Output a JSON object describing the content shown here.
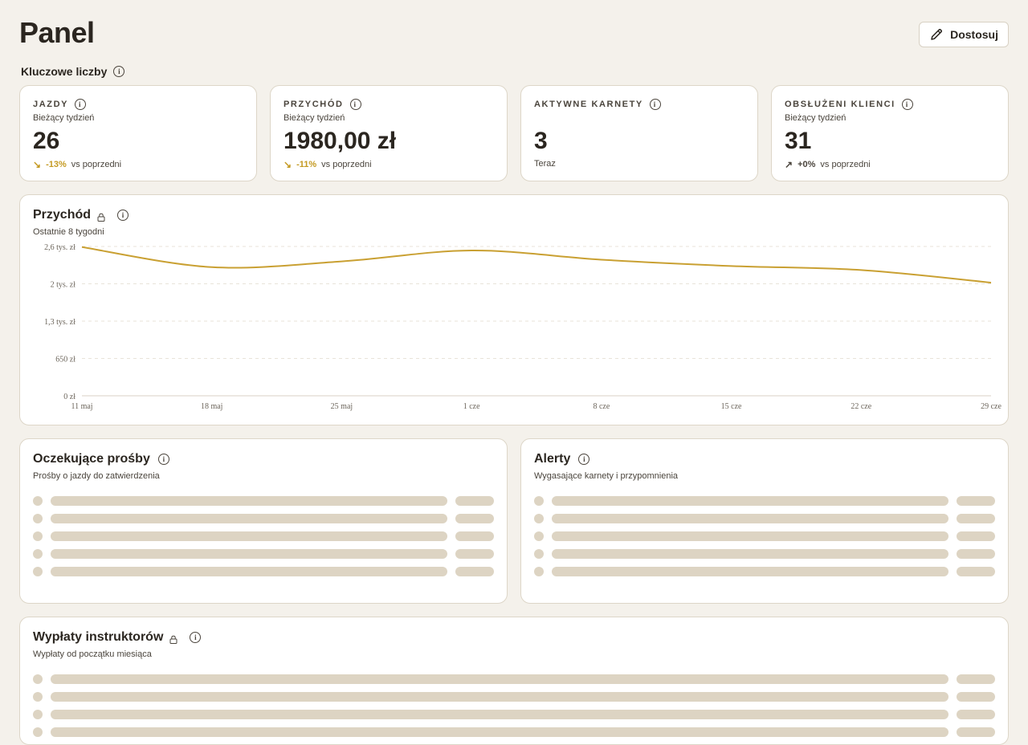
{
  "header": {
    "title": "Panel",
    "customize_label": "Dostosuj"
  },
  "key_numbers": {
    "label": "Kluczowe liczby",
    "cards": [
      {
        "title": "JAZDY",
        "period": "Bieżący tydzień",
        "value": "26",
        "delta": "-13%",
        "delta_suffix": "vs poprzedni",
        "trend": "down"
      },
      {
        "title": "PRZYCHÓD",
        "period": "Bieżący tydzień",
        "value": "1980,00 zł",
        "delta": "-11%",
        "delta_suffix": "vs poprzedni",
        "trend": "down"
      },
      {
        "title": "AKTYWNE KARNETY",
        "period": "",
        "value": "3",
        "delta": "",
        "delta_suffix": "Teraz",
        "trend": "none"
      },
      {
        "title": "OBSŁUŻENI KLIENCI",
        "period": "Bieżący tydzień",
        "value": "31",
        "delta": "+0%",
        "delta_suffix": "vs poprzedni",
        "trend": "up"
      }
    ]
  },
  "revenue_chart": {
    "title": "Przychód",
    "subtitle": "Ostatnie 8 tygodni",
    "line_color": "#c9a032"
  },
  "chart_data": {
    "type": "line",
    "x": [
      "11 maj",
      "18 maj",
      "25 maj",
      "1 cze",
      "8 cze",
      "15 cze",
      "22 cze",
      "29 cze"
    ],
    "series": [
      {
        "values": [
          2590,
          2240,
          2340,
          2530,
          2370,
          2260,
          2190,
          1970
        ]
      }
    ],
    "y_ticks": [
      "0 zł",
      "650 zł",
      "1,3 tys. zł",
      "2 tys. zł",
      "2,6 tys. zł"
    ],
    "y_tick_values": [
      0,
      650,
      1300,
      1950,
      2600
    ],
    "ylim": [
      0,
      2600
    ],
    "grid": true
  },
  "pending_requests": {
    "title": "Oczekujące prośby",
    "subtitle": "Prośby o jazdy do zatwierdzenia",
    "rows": 5
  },
  "alerts": {
    "title": "Alerty",
    "subtitle": "Wygasające karnety i przypomnienia",
    "rows": 5
  },
  "payouts": {
    "title": "Wypłaty instruktorów",
    "subtitle": "Wypłaty od początku miesiąca",
    "rows": 4
  },
  "colors": {
    "background": "#f4f1eb",
    "accent": "#c9a032",
    "skeleton": "#ddd4c3"
  }
}
